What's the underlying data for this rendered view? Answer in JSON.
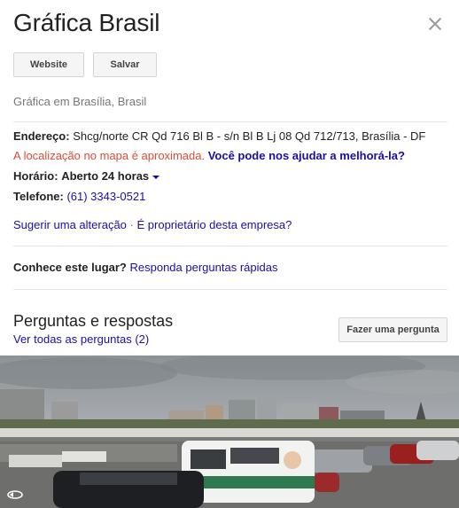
{
  "header": {
    "title": "Gráfica Brasil"
  },
  "buttons": {
    "website": "Website",
    "save": "Salvar"
  },
  "category": "Gráfica em Brasília, Brasil",
  "address": {
    "label": "Endereço:",
    "value": "Shcg/norte CR Qd 716 Bl B - s/n Bl B Lj 08 Qd 712/713, Brasília - DF"
  },
  "location_note": {
    "warning": "A localização no mapa é aproximada.",
    "help_link": "Você pode nos ajudar a melhorá-la?"
  },
  "hours": {
    "label": "Horário:",
    "value": "Aberto 24 horas"
  },
  "phone": {
    "label": "Telefone:",
    "value": "(61) 3343-0521"
  },
  "edit": {
    "suggest": "Sugerir uma alteração",
    "separator": "·",
    "owner": "É proprietário desta empresa?"
  },
  "know": {
    "label": "Conhece este lugar?",
    "link": "Responda perguntas rápidas"
  },
  "qa": {
    "title": "Perguntas e respostas",
    "see_all": "Ver todas as perguntas (2)",
    "ask_button": "Fazer uma pergunta"
  },
  "colors": {
    "link": "#1a0dab",
    "warning": "#dd4b39",
    "text": "#222222",
    "muted": "#777777"
  },
  "icons": {
    "close": "close-icon",
    "hours_toggle": "caret-down-icon",
    "photo_rotate": "360-rotate-icon"
  }
}
